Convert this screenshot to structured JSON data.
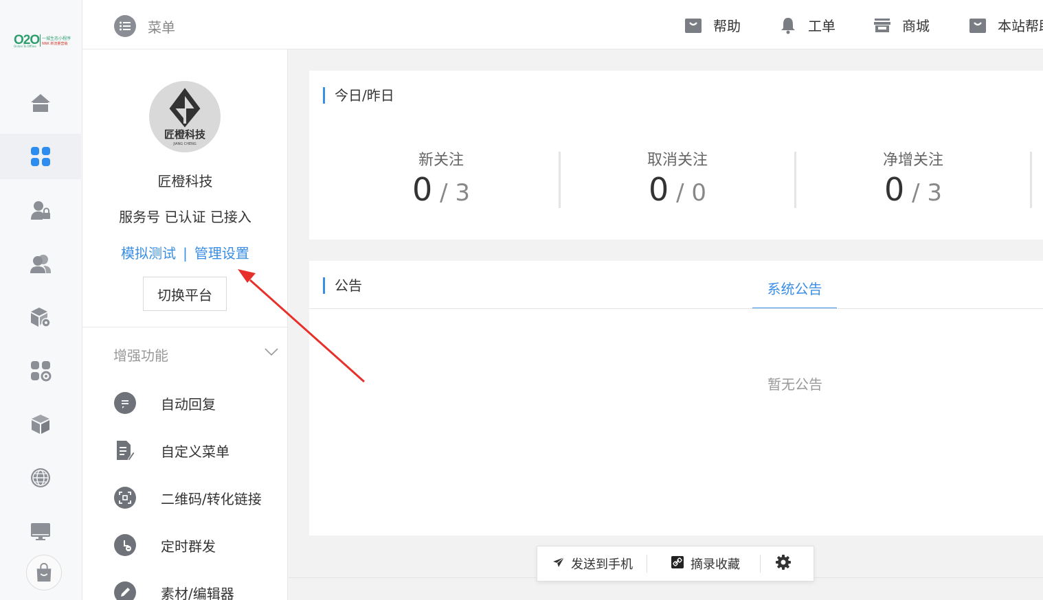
{
  "brand": {
    "logo_text": "O2O",
    "logo_sub": "Online To Offline",
    "logo_tag1": "一城生态小程序",
    "logo_tag2": "NNK 新流量营销"
  },
  "topbar": {
    "menu_label": "菜单",
    "nav": [
      {
        "label": "帮助",
        "icon": "bag-icon"
      },
      {
        "label": "工单",
        "icon": "bell-icon"
      },
      {
        "label": "商城",
        "icon": "store-icon"
      },
      {
        "label": "本站帮助",
        "icon": "bag-icon"
      }
    ]
  },
  "rail": {
    "items": [
      "home-icon",
      "apps-icon",
      "user-lock-icon",
      "users-icon",
      "box-gear-icon",
      "apps-gear-icon",
      "cube-icon",
      "globe-icon",
      "monitor-icon"
    ],
    "active_index": 1
  },
  "account": {
    "avatar_text": "匠橙科技",
    "avatar_sub": "JIANG CHENG",
    "name": "匠橙科技",
    "status": "服务号 已认证 已接入",
    "link_test": "模拟测试",
    "link_sep": "|",
    "link_manage": "管理设置",
    "switch_label": "切换平台"
  },
  "enhance": {
    "title": "增强功能",
    "items": [
      {
        "label": "自动回复",
        "icon": "chat-bubble-icon"
      },
      {
        "label": "自定义菜单",
        "icon": "document-edit-icon"
      },
      {
        "label": "二维码/转化链接",
        "icon": "qrcode-scan-icon"
      },
      {
        "label": "定时群发",
        "icon": "clock-icon"
      },
      {
        "label": "素材/编辑器",
        "icon": "pencil-icon"
      }
    ]
  },
  "stats": {
    "title": "今日/昨日",
    "items": [
      {
        "label": "新关注",
        "today": "0",
        "yesterday": "3"
      },
      {
        "label": "取消关注",
        "today": "0",
        "yesterday": "0"
      },
      {
        "label": "净增关注",
        "today": "0",
        "yesterday": "3"
      }
    ],
    "slash": "/"
  },
  "notice": {
    "title": "公告",
    "tab": "系统公告",
    "empty": "暂无公告"
  },
  "floatbar": {
    "send_label": "发送到手机",
    "collect_label": "摘录收藏"
  },
  "colors": {
    "accent": "#3a8ee6",
    "annotation": "#e8302a"
  }
}
